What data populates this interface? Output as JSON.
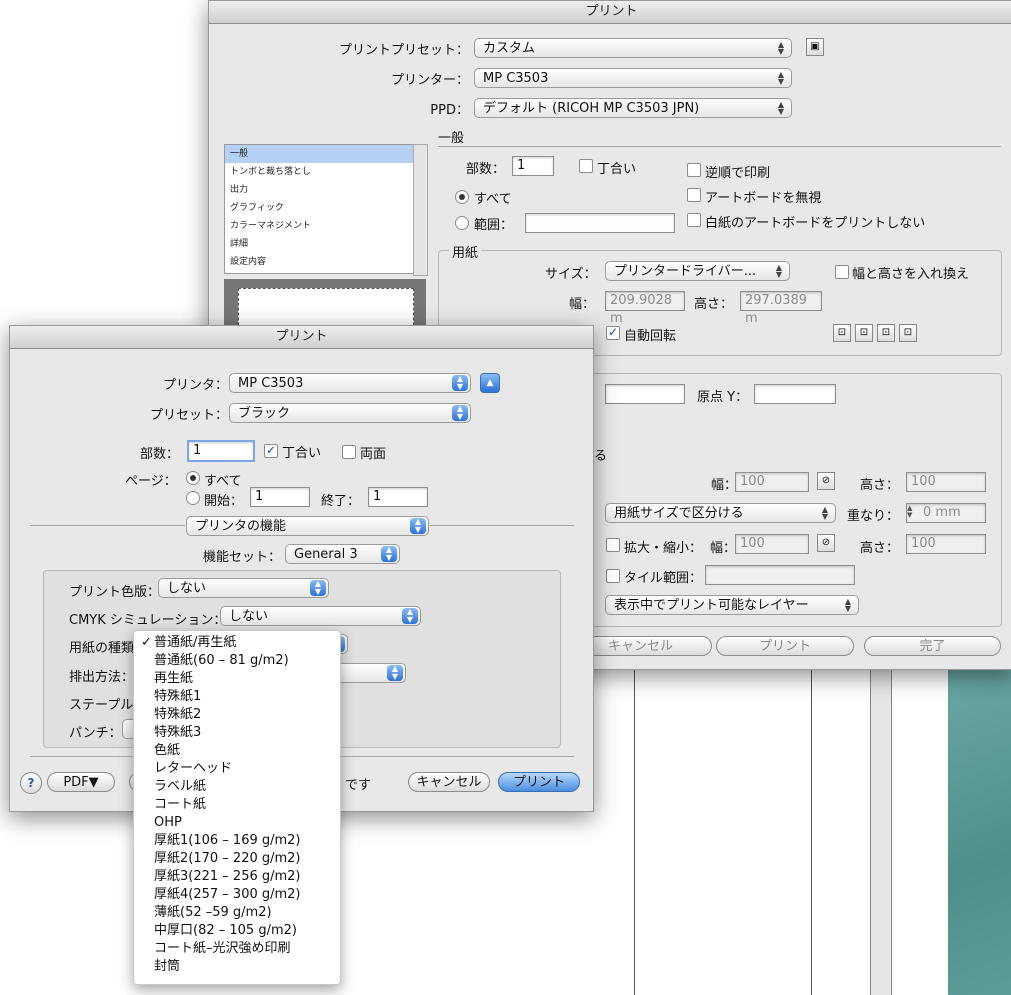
{
  "illustrator_dialog": {
    "title": "プリント",
    "preset_label": "プリントプリセット：",
    "preset_value": "カスタム",
    "printer_label": "プリンター：",
    "printer_value": "MP C3503",
    "ppd_label": "PPD：",
    "ppd_value": "デフォルト (RICOH MP C3503 JPN)",
    "section_general": "一般",
    "sidebar_items": [
      "一般",
      "トンボと裁ち落とし",
      "出力",
      "グラフィック",
      "カラーマネジメント",
      "詳細",
      "設定内容"
    ],
    "copies_label": "部数：",
    "copies_value": "1",
    "collate_label": "丁合い",
    "reverse_label": "逆順で印刷",
    "all_label": "すべて",
    "ignore_artboards_label": "アートボードを無視",
    "range_label": "範囲：",
    "skip_blank_label": "白紙のアートボードをプリントしない",
    "paper_section": "用紙",
    "size_label": "サイズ：",
    "size_value": "プリンタードライバー...",
    "swap_label": "幅と高さを入れ換え",
    "width_label": "幅：",
    "width_value": "209.9028 m",
    "height_label": "高さ：",
    "height_value": "297.0389 m",
    "auto_rotate_label": "自動回転",
    "origin_y_label": "原点 Y：",
    "ru_text": "る",
    "tile_w_label": "幅：",
    "tile_w_value": "100",
    "tile_h_label": "高さ：",
    "tile_h_value": "100",
    "split_value": "用紙サイズで区分ける",
    "overlap_label": "重なり：",
    "overlap_value": "0 mm",
    "scale_label": "拡大・縮小：",
    "scale_w_label": "幅：",
    "scale_w_value": "100",
    "scale_h_label": "高さ：",
    "scale_h_value": "100",
    "tile_range_label": "タイル範囲：",
    "layers_value": "表示中でプリント可能なレイヤー",
    "cancel_button": "キャンセル",
    "print_button": "プリント",
    "done_button": "完了"
  },
  "mac_dialog": {
    "title": "プリント",
    "printer_label": "プリンタ：",
    "printer_value": "MP C3503",
    "preset_label": "プリセット：",
    "preset_value": "ブラック",
    "copies_label": "部数：",
    "copies_value": "1",
    "collate_label": "丁合い",
    "duplex_label": "両面",
    "pages_label": "ページ：",
    "all_label": "すべて",
    "from_label": "開始：",
    "from_value": "1",
    "to_label": "終了：",
    "to_value": "1",
    "panel_value": "プリンタの機能",
    "feature_set_label": "機能セット：",
    "feature_set_value": "General 3",
    "color_plate_label": "プリント色版：",
    "color_plate_value": "しない",
    "cmyk_label": "CMYK シミュレーション：",
    "cmyk_value": "しない",
    "paper_type_label": "用紙の種類：",
    "output_label": "排出方法：",
    "staple_label": "ステープル：",
    "punch_label": "パンチ：",
    "help_label": "?",
    "pdf_label": "PDF▼",
    "status_text": "です",
    "cancel_button": "キャンセル",
    "print_button": "プリント"
  },
  "paper_menu": {
    "check": "✓",
    "items": [
      "普通紙/再生紙",
      "普通紙(60 – 81 g/m2)",
      "再生紙",
      "特殊紙1",
      "特殊紙2",
      "特殊紙3",
      "色紙",
      "レターヘッド",
      "ラベル紙",
      "コート紙",
      "OHP",
      "厚紙1(106 – 169 g/m2)",
      "厚紙2(170 – 220 g/m2)",
      "厚紙3(221 – 256 g/m2)",
      "厚紙4(257 – 300 g/m2)",
      "薄紙(52 –59 g/m2)",
      "中厚口(82 – 105 g/m2)",
      "コート紙–光沢強め印刷",
      "封筒"
    ]
  },
  "colors": {
    "accent": "#3a7fe0",
    "selection": "#b5d0f4",
    "window": "#e8e8e8"
  }
}
